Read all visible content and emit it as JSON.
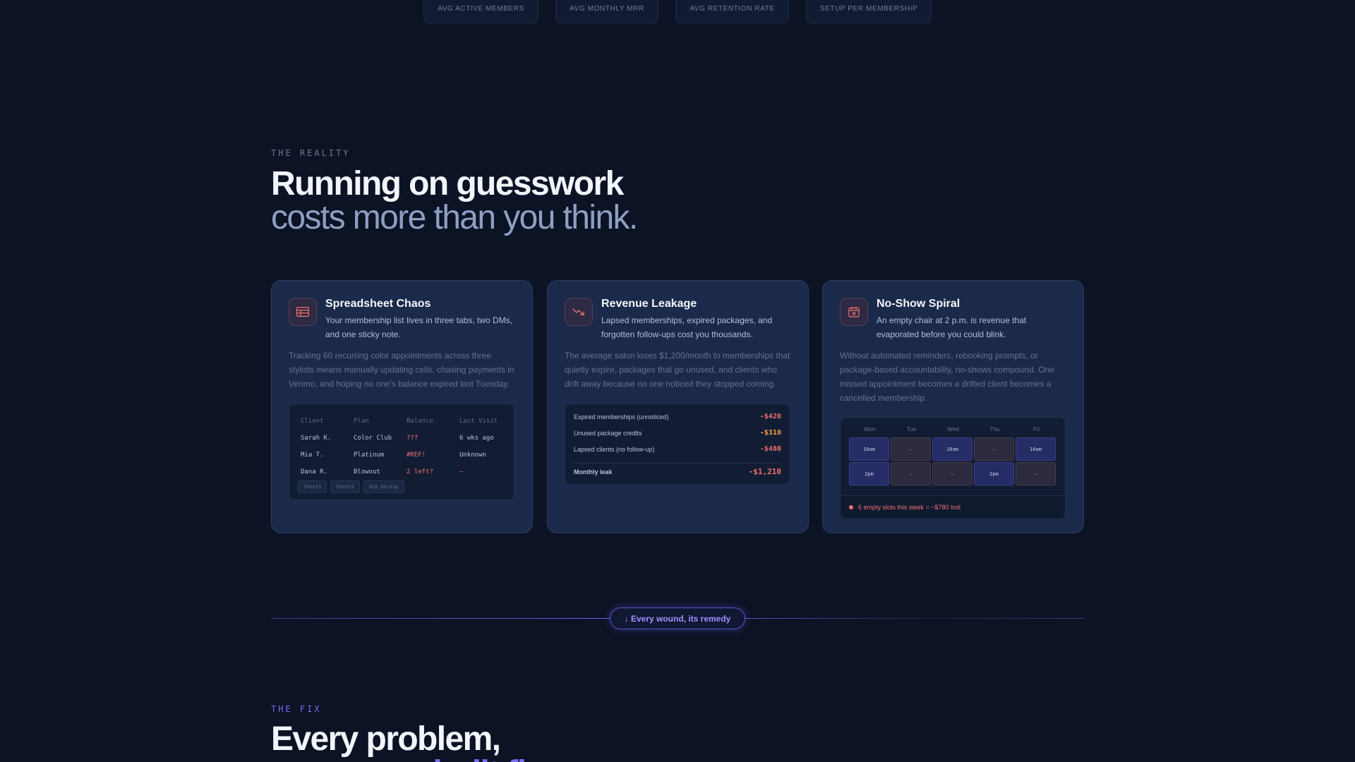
{
  "stats": {
    "tabs": [
      "AVG ACTIVE MEMBERS",
      "AVG MONTHLY MRR",
      "AVG RETENTION RATE",
      "SETUP PER MEMBERSHIP"
    ]
  },
  "reality": {
    "eyebrow": "THE REALITY",
    "headline_1": "Running on guesswork",
    "headline_2": "costs more than you think."
  },
  "cards": [
    {
      "icon": "spreadsheet-icon",
      "title": "Spreadsheet Chaos",
      "subtitle": "Your membership list lives in three tabs, two DMs, and one sticky note.",
      "body": "Tracking 60 recurring color appointments across three stylists means manually updating cells, chasing payments in Venmo, and hoping no one's balance expired last Tuesday.",
      "sheet": {
        "headers": [
          "Client",
          "Plan",
          "Balance",
          "Last Visit"
        ],
        "rows": [
          [
            "Sarah K.",
            "Color Club",
            "???",
            "6 wks ago"
          ],
          [
            "Mia T.",
            "Platinum",
            "#REF!",
            "Unknown"
          ],
          [
            "Dana R.",
            "Blowout",
            "2 left?",
            "—"
          ]
        ],
        "tabs": [
          "Sheet1",
          "Sheet2",
          "OLD_backup"
        ]
      }
    },
    {
      "icon": "trending-down-icon",
      "title": "Revenue Leakage",
      "subtitle": "Lapsed memberships, expired packages, and forgotten follow-ups cost you thousands.",
      "body": "The average salon loses $1,200/month to memberships that quietly expire, packages that go unused, and clients who drift away because no one noticed they stopped coming.",
      "leaks": [
        {
          "label": "Expired memberships (unnoticed)",
          "amount": "-$420"
        },
        {
          "label": "Unused package credits",
          "amount": "-$310"
        },
        {
          "label": "Lapsed clients (no follow-up)",
          "amount": "-$480"
        }
      ],
      "total_label": "Monthly leak",
      "total_amount": "-$1,210"
    },
    {
      "icon": "calendar-x-icon",
      "title": "No-Show Spiral",
      "subtitle": "An empty chair at 2 p.m. is revenue that evaporated before you could blink.",
      "body": "Without automated reminders, rebooking prompts, or package-based accountability, no-shows compound. One missed appointment becomes a drifted client becomes a cancelled membership.",
      "calendar": {
        "days": [
          "Mon",
          "Tue",
          "Wed",
          "Thu",
          "Fri"
        ],
        "row1": [
          "10am",
          "—",
          "10am",
          "—",
          "10am"
        ],
        "row2": [
          "2pm",
          "—",
          "—",
          "2pm",
          "—"
        ],
        "footer": "6 empty slots this week = ~$780 lost"
      }
    }
  ],
  "divider": {
    "label": "↓ Every wound, its remedy"
  },
  "fix": {
    "eyebrow": "THE FIX",
    "headline_1": "Every problem,",
    "headline_2": "a purpose-built fix."
  },
  "colors": {
    "background": "#0b1324",
    "card": "#1b2a4a",
    "accent": "#7b6cf0",
    "danger": "#f07070",
    "warning": "#f0a048"
  }
}
